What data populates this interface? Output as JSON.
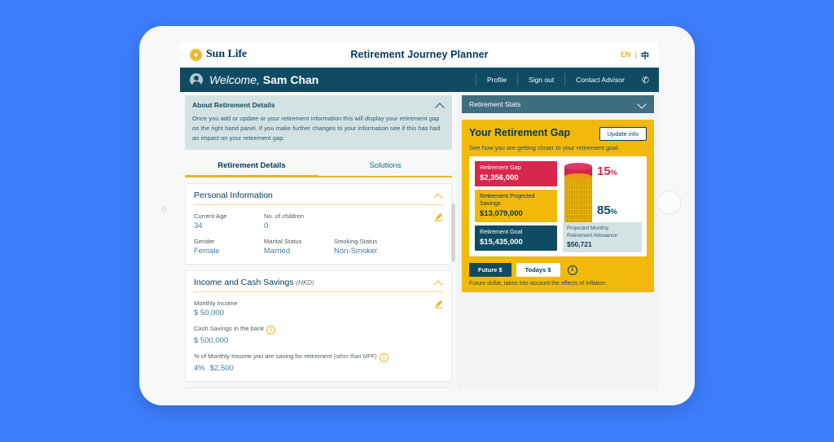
{
  "topbar": {
    "brand": "Sun Life",
    "app_title": "Retirement Journey Planner",
    "lang_en": "EN",
    "lang_sep": "|",
    "lang_zh": "中"
  },
  "welcome": {
    "greeting_prefix": "Welcome, ",
    "user_name": "Sam Chan",
    "profile": "Profile",
    "sign_out": "Sign out",
    "contact_advisor": "Contact Advisor",
    "phone_icon": "✆"
  },
  "about": {
    "title": "About Retirement Details",
    "text": "Once you add or update or your retirement information this will display your retirement gap on the right hand panel. If you make further changes to your information see if this has had an impact on your retirement gap."
  },
  "tabs": [
    {
      "label": "Retirement Details",
      "active": true
    },
    {
      "label": "Solutions",
      "active": false
    }
  ],
  "personal_information": {
    "title": "Personal Information",
    "fields": [
      {
        "label": "Current Age",
        "value": "34"
      },
      {
        "label": "No. of children",
        "value": "0"
      },
      {
        "label": "Gender",
        "value": "Female"
      },
      {
        "label": "Marital Status",
        "value": "Married"
      },
      {
        "label": "Smoking Status",
        "value": "Non-Smoker"
      }
    ]
  },
  "income_savings": {
    "title": "Income and Cash Savings",
    "unit": "(HKD)",
    "monthly_income_label": "Monthly Income",
    "monthly_income_value": "$ 50,000",
    "cash_savings_label": "Cash Savings in the bank",
    "cash_savings_value": "$ 500,000",
    "pct_label": "% of Monthly Income you are saving for retirement",
    "pct_note": "(other than MPF)",
    "pct_value": "4%",
    "pct_amount": "$2,500"
  },
  "right_panel": {
    "stats_header": "Retirement Stats",
    "gap_title": "Your Retirement Gap",
    "update_button": "Update info",
    "gap_subtitle": "See how you are getting closer to your retirement goal.",
    "footnote": "Future dollar, takes into account the effects of inflation.",
    "toggle": [
      {
        "label": "Future $",
        "active": true
      },
      {
        "label": "Todays $",
        "active": false
      }
    ],
    "allowance_label_line1": "Projected Monthly",
    "allowance_label_line2": "Retirement Allowance",
    "allowance_value": "$50,721"
  },
  "chart_data": {
    "type": "bar",
    "title": "Your Retirement Gap",
    "categories": [
      "Retirement Gap",
      "Retirement Projected Savings",
      "Retirement Goal"
    ],
    "values": [
      2356000,
      13079000,
      15435000
    ],
    "value_labels": [
      "$2,356,000",
      "$13,079,000",
      "$15,435,000"
    ],
    "colors": [
      "#d8274d",
      "#f2b90a",
      "#0f4c64"
    ],
    "currency": "HKD",
    "segments": [
      {
        "name": "Retirement Gap",
        "percent": 15,
        "percent_label": "15",
        "percent_symbol": "%",
        "color": "#d8274d"
      },
      {
        "name": "Retirement Projected Savings",
        "percent": 85,
        "percent_label": "85",
        "percent_symbol": "%",
        "color": "#f2b90a"
      }
    ],
    "annotations": [
      {
        "label": "Projected Monthly Retirement Allowance",
        "value": "$50,721"
      }
    ],
    "legend_position": "none",
    "grid": false
  },
  "icons": {
    "chevron_up": "chevron-up",
    "chevron_down": "chevron-down",
    "pencil": "pencil",
    "info": "i"
  }
}
